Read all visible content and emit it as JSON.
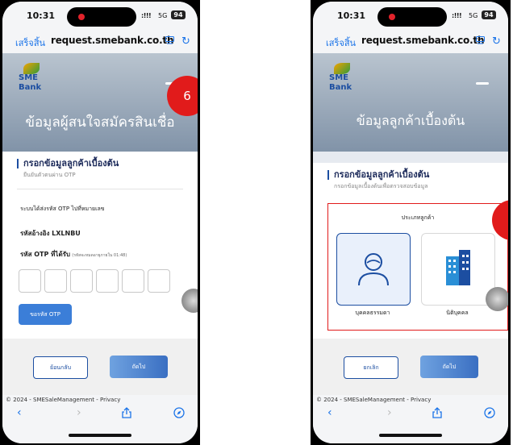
{
  "status_bar": {
    "time": "10:31",
    "network": "5G",
    "battery": "94",
    "signal": ":!!!"
  },
  "browser": {
    "done_label": "เสร็จสิ้น",
    "url": "request.smebank.co.th"
  },
  "logo": {
    "line1": "SME",
    "line2": "Bank"
  },
  "left_screen": {
    "banner_title": "ข้อมูลผู้สนใจสมัครสินเชื่อ",
    "section_title": "กรอกข้อมูลลูกค้าเบื้องต้น",
    "section_subtitle": "ยืนยันตัวตนผ่าน OTP",
    "otp_sent_text": "ระบบได้ส่งรหัส OTP ไปที่หมายเลข",
    "ref_code": "รหัสอ้างอิง LXLNBU",
    "otp_label": "รหัส OTP ที่ได้รับ",
    "otp_expiry": "(รหัสจะหมดอายุภายใน 01:48)",
    "request_otp_label": "ขอรหัส OTP",
    "back_label": "ย้อนกลับ",
    "next_label": "ถัดไป",
    "step_number": "6"
  },
  "right_screen": {
    "banner_title": "ข้อมูลลูกค้าเบื้องต้น",
    "section_title": "กรอกข้อมูลลูกค้าเบื้องต้น",
    "section_subtitle": "กรอกข้อมูลเบื้องต้นเพื่อตรวจสอบข้อมูล",
    "customer_type_title": "ประเภทลูกค้า",
    "individual_label": "บุคคลธรรมดา",
    "juristic_label": "นิติบุคคล",
    "cancel_label": "ยกเลิก",
    "next_label": "ถัดไป"
  },
  "footer": {
    "copyright": "© 2024 - SMESaleManagement - Privacy"
  },
  "colors": {
    "accent": "#1c4ea1",
    "badge": "#e11b1b",
    "link": "#1a73e8"
  }
}
